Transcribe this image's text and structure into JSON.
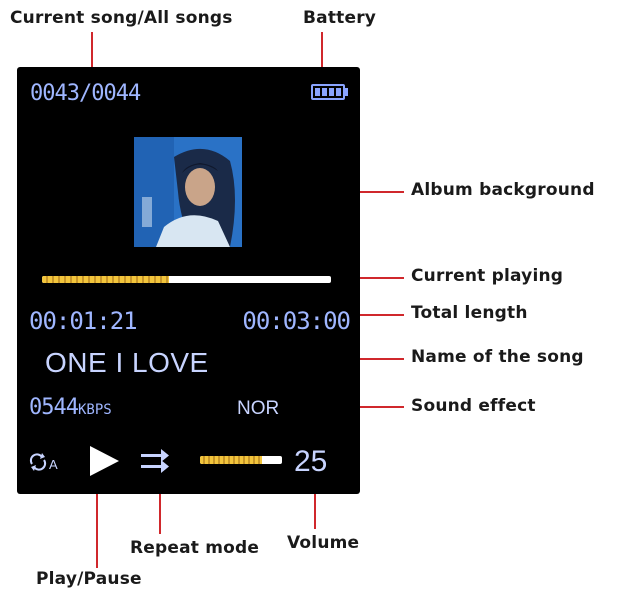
{
  "annotations": {
    "current_song_all_songs": "Current song/All songs",
    "battery": "Battery",
    "album_background": "Album background",
    "current_playing": "Current playing",
    "total_length": "Total length",
    "name_of_the_song": "Name of the song",
    "sound_effect": "Sound effect",
    "repeat_mode": "Repeat mode",
    "volume": "Volume",
    "play_pause": "Play/Pause"
  },
  "player": {
    "track_counter": "0043/0044",
    "battery_icon": "battery-full-icon",
    "album_art_icon": "album-art-portrait",
    "progress_fraction": 0.44,
    "current_time": "00:01:21",
    "total_time": "00:03:00",
    "song_name": "ONE I LOVE",
    "bitrate_value": "0544",
    "bitrate_unit": "KBPS",
    "sound_effect": "NOR",
    "repeat_icon": "repeat-all-icon",
    "repeat_label": "A",
    "play_icon": "play-icon",
    "shuffle_icon": "repeat-mode-icon",
    "volume_fraction": 0.75,
    "volume_value": "25"
  },
  "colors": {
    "screen_background": "#000000",
    "display_text": "#9fb6ff",
    "progress_fill": "#f2c53c",
    "annotation_line": "#d0282c"
  }
}
